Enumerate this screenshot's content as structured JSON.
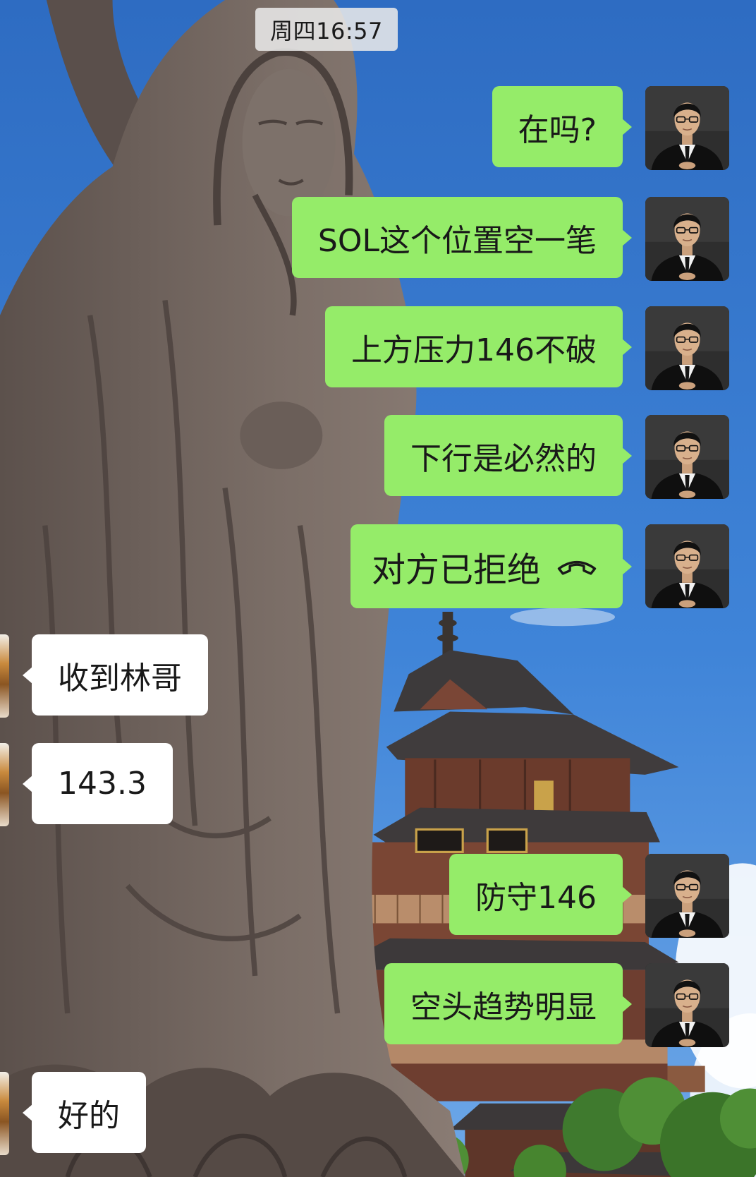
{
  "status": {
    "time_label": "周四16:57"
  },
  "messages": [
    {
      "direction": "out",
      "text": "在吗?"
    },
    {
      "direction": "out",
      "text": "SOL这个位置空一笔"
    },
    {
      "direction": "out",
      "text": "上方压力146不破"
    },
    {
      "direction": "out",
      "text": "下行是必然的"
    },
    {
      "direction": "out",
      "text": "对方已拒绝",
      "icon": "phone-hangup-icon"
    },
    {
      "direction": "in",
      "text": "收到林哥"
    },
    {
      "direction": "in",
      "text": "143.3"
    },
    {
      "direction": "out",
      "text": "防守146"
    },
    {
      "direction": "out",
      "text": "空头趋势明显"
    },
    {
      "direction": "in",
      "text": "好的"
    }
  ],
  "colors": {
    "outgoing_bubble": "#95ec69",
    "incoming_bubble": "#ffffff",
    "message_text": "#191919"
  },
  "icons": {
    "self_avatar": "man-in-suit-avatar",
    "contact_avatar": "contact-avatar"
  }
}
